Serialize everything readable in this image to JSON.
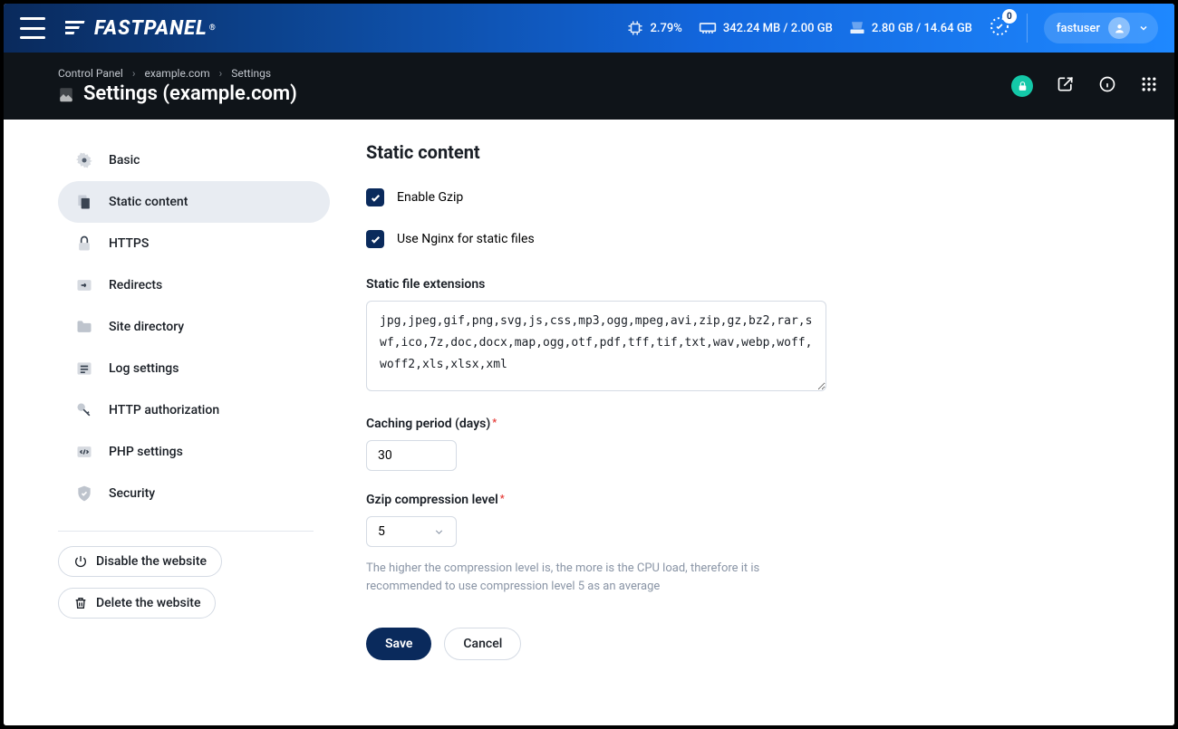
{
  "header": {
    "logo_text": "FASTPANEL",
    "cpu": "2.79%",
    "ram": "342.24 MB / 2.00 GB",
    "disk": "2.80 GB / 14.64 GB",
    "notif_count": "0",
    "username": "fastuser"
  },
  "breadcrumb": [
    "Control Panel",
    "example.com",
    "Settings"
  ],
  "page_title": "Settings (example.com)",
  "sidebar": {
    "items": [
      {
        "label": "Basic"
      },
      {
        "label": "Static content"
      },
      {
        "label": "HTTPS"
      },
      {
        "label": "Redirects"
      },
      {
        "label": "Site directory"
      },
      {
        "label": "Log settings"
      },
      {
        "label": "HTTP authorization"
      },
      {
        "label": "PHP settings"
      },
      {
        "label": "Security"
      }
    ],
    "disable_label": "Disable the website",
    "delete_label": "Delete the website"
  },
  "form": {
    "heading": "Static content",
    "gzip_label": "Enable Gzip",
    "nginx_label": "Use Nginx for static files",
    "ext_label": "Static file extensions",
    "ext_value": "jpg,jpeg,gif,png,svg,js,css,mp3,ogg,mpeg,avi,zip,gz,bz2,rar,swf,ico,7z,doc,docx,map,ogg,otf,pdf,tff,tif,txt,wav,webp,woff,woff2,xls,xlsx,xml",
    "cache_label": "Caching period (days)",
    "cache_value": "30",
    "level_label": "Gzip compression level",
    "level_value": "5",
    "help_text": "The higher the compression level is, the more is the CPU load, therefore it is recommended to use compression level 5 as an average",
    "save": "Save",
    "cancel": "Cancel"
  }
}
